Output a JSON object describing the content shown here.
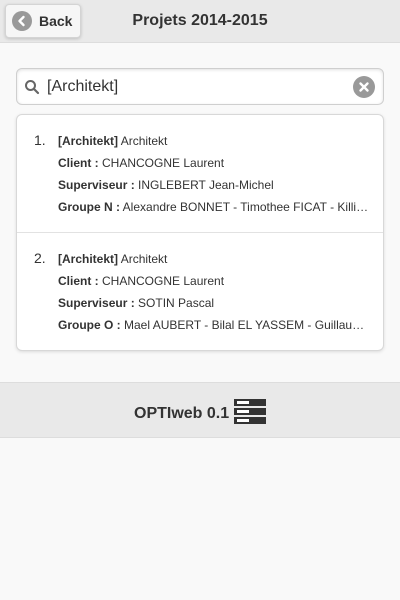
{
  "header": {
    "back_label": "Back",
    "title": "Projets 2014-2015"
  },
  "search": {
    "value": "[Architekt]"
  },
  "results": [
    {
      "number": "1.",
      "tag": "[Architekt]",
      "name": "Architekt",
      "client_label": "Client :",
      "client": "CHANCOGNE Laurent",
      "supervisor_label": "Superviseur :",
      "supervisor": "INGLEBERT Jean-Michel",
      "group_label": "Groupe N :",
      "group": "Alexandre BONNET - Timothee FICAT - Killia…"
    },
    {
      "number": "2.",
      "tag": "[Architekt]",
      "name": "Architekt",
      "client_label": "Client :",
      "client": "CHANCOGNE Laurent",
      "supervisor_label": "Superviseur :",
      "supervisor": "SOTIN Pascal",
      "group_label": "Groupe O :",
      "group": "Mael AUBERT - Bilal EL YASSEM - Guillaum…"
    }
  ],
  "footer": {
    "brand": "OPTIweb 0.1",
    "icon": "server-icon"
  },
  "colors": {
    "bar_bg": "#e9e9e9",
    "page_bg": "#f9f9f9",
    "icon_gray": "#999999",
    "text": "#333333"
  }
}
